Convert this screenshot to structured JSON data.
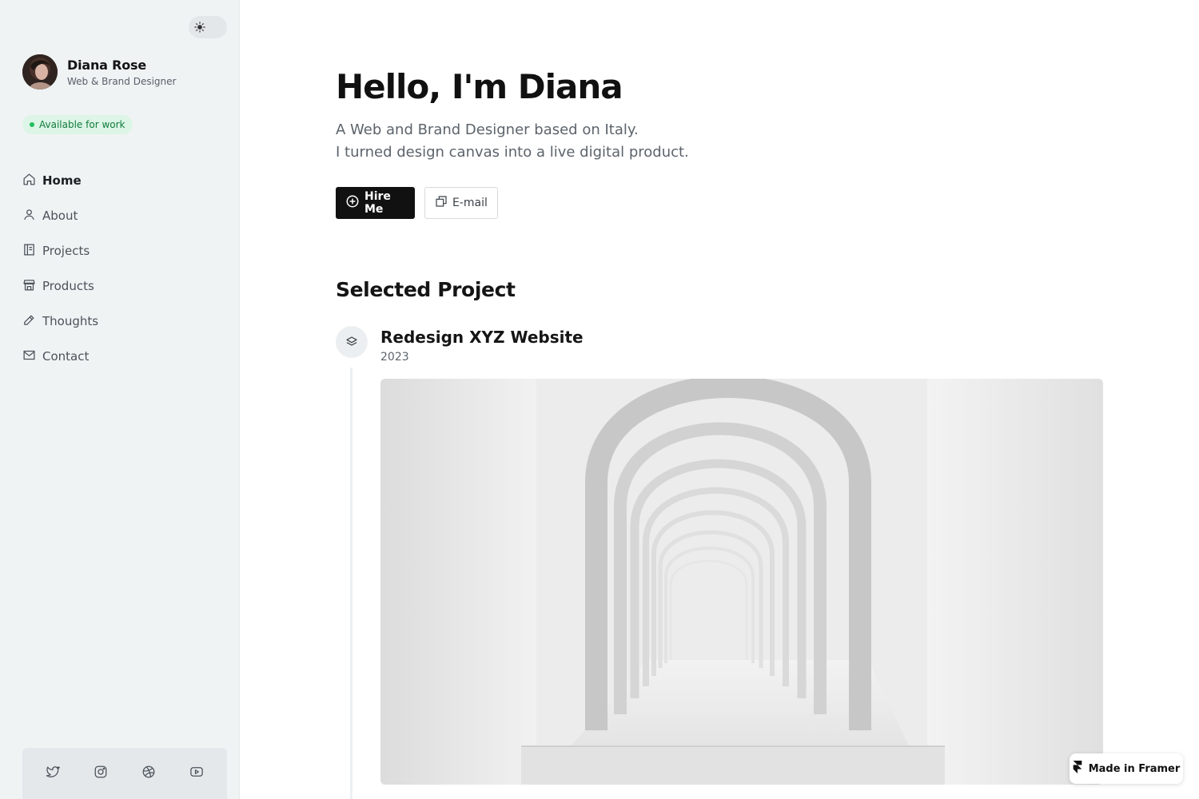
{
  "profile": {
    "name": "Diana Rose",
    "role": "Web & Brand Designer",
    "status": "Available for work"
  },
  "nav": [
    {
      "label": "Home",
      "icon": "home-icon",
      "active": true
    },
    {
      "label": "About",
      "icon": "user-icon",
      "active": false
    },
    {
      "label": "Projects",
      "icon": "projects-icon",
      "active": false
    },
    {
      "label": "Products",
      "icon": "store-icon",
      "active": false
    },
    {
      "label": "Thoughts",
      "icon": "pencil-icon",
      "active": false
    },
    {
      "label": "Contact",
      "icon": "mail-icon",
      "active": false
    }
  ],
  "social": [
    "twitter-icon",
    "instagram-icon",
    "dribbble-icon",
    "youtube-icon"
  ],
  "hero": {
    "title": "Hello, I'm Diana",
    "line1": "A Web and Brand Designer based on Italy.",
    "line2": "I turned design canvas into a live digital product.",
    "hire_label": "Hire Me",
    "email_label": "E-mail"
  },
  "selected": {
    "heading": "Selected Project",
    "project_title": "Redesign XYZ Website",
    "project_year": "2023"
  },
  "footer_badge": "Made in Framer",
  "colors": {
    "sidebar_bg": "#f0f3f4",
    "accent_dark": "#111111",
    "status_green": "#1fbf5f",
    "status_bg": "#dcf5e6"
  }
}
